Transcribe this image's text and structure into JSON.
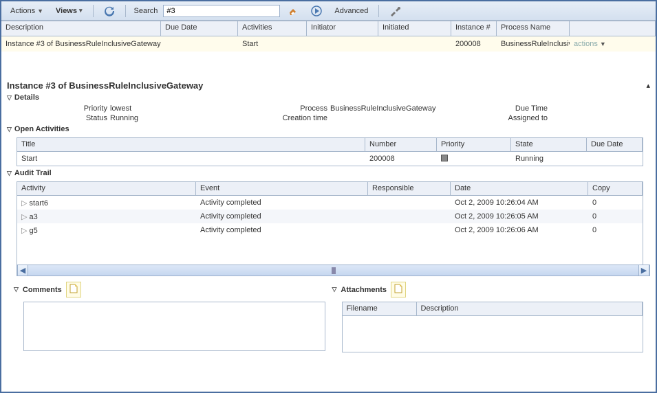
{
  "toolbar": {
    "actions_label": "Actions",
    "views_label": "Views",
    "search_label": "Search",
    "search_value": "#3",
    "advanced_label": "Advanced"
  },
  "grid": {
    "headers": {
      "description": "Description",
      "due_date": "Due Date",
      "activities": "Activities",
      "initiator": "Initiator",
      "initiated": "Initiated",
      "instance_num": "Instance #",
      "process_name": "Process Name"
    },
    "row": {
      "description": "Instance #3 of BusinessRuleInclusiveGateway",
      "activities": "Start",
      "instance_num": "200008",
      "process_name": "BusinessRuleInclusive",
      "actions_link": "actions"
    }
  },
  "detail": {
    "title": "Instance #3 of BusinessRuleInclusiveGateway",
    "details_section": "Details",
    "labels": {
      "priority": "Priority",
      "status": "Status",
      "process": "Process",
      "creation_time": "Creation time",
      "due_time": "Due Time",
      "assigned_to": "Assigned to"
    },
    "values": {
      "priority": "lowest",
      "status": "Running",
      "process": "BusinessRuleInclusiveGateway"
    }
  },
  "open_activities": {
    "title": "Open Activities",
    "headers": {
      "title": "Title",
      "number": "Number",
      "priority": "Priority",
      "state": "State",
      "due_date": "Due Date"
    },
    "row": {
      "title": "Start",
      "number": "200008",
      "state": "Running"
    }
  },
  "audit_trail": {
    "title": "Audit Trail",
    "headers": {
      "activity": "Activity",
      "event": "Event",
      "responsible": "Responsible",
      "date": "Date",
      "copy": "Copy"
    },
    "rows": [
      {
        "activity": "start6",
        "event": "Activity completed",
        "date": "Oct 2, 2009 10:26:04 AM",
        "copy": "0"
      },
      {
        "activity": "a3",
        "event": "Activity completed",
        "date": "Oct 2, 2009 10:26:05 AM",
        "copy": "0"
      },
      {
        "activity": "g5",
        "event": "Activity completed",
        "date": "Oct 2, 2009 10:26:06 AM",
        "copy": "0"
      }
    ]
  },
  "comments": {
    "title": "Comments"
  },
  "attachments": {
    "title": "Attachments",
    "headers": {
      "filename": "Filename",
      "description": "Description"
    }
  }
}
